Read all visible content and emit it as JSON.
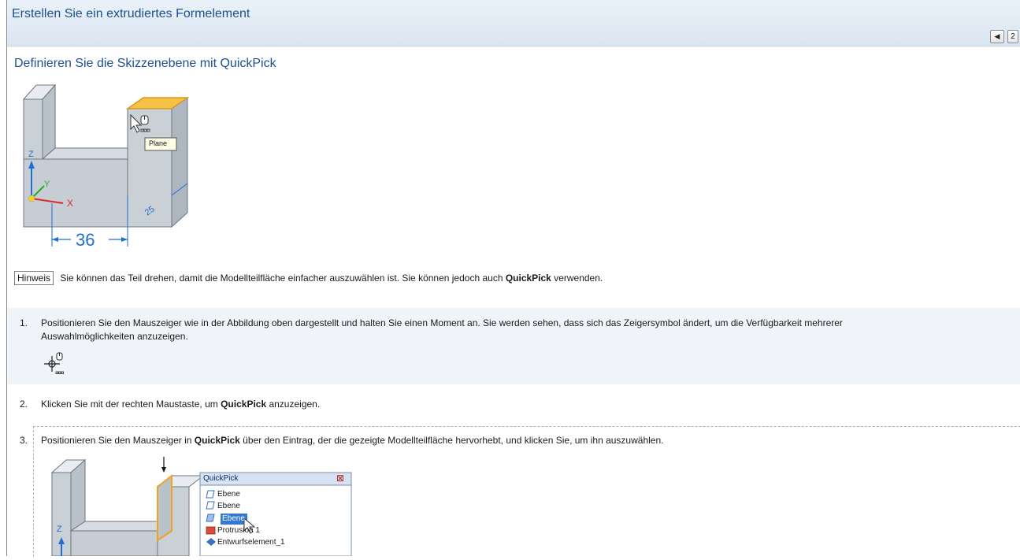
{
  "header": {
    "title": "Erstellen Sie ein extrudiertes Formelement",
    "nav_back_icon": "◀",
    "nav_page": "2"
  },
  "section": {
    "heading": "Definieren Sie die Skizzenebene mit QuickPick"
  },
  "figure1": {
    "tooltip": "Plane",
    "axis_z": "Z",
    "axis_y": "Y",
    "axis_x": "X",
    "dimension": "36",
    "small_dimension": "25",
    "colors": {
      "highlight_face": "#f5c146",
      "axis_blue": "#1f6ed4",
      "axis_red": "#e0262a",
      "axis_green": "#2aa82a"
    }
  },
  "hint": {
    "label": "Hinweis",
    "text_before": " Sie können das Teil drehen, damit die Modellteilfläche einfacher auszuwählen ist. Sie können jedoch auch ",
    "bold": "QuickPick",
    "text_after": " verwenden."
  },
  "steps": [
    {
      "number": "1.",
      "line1": "Positionieren Sie den Mauszeiger wie in der Abbildung oben dargestellt und halten Sie einen Moment an. Sie werden sehen, dass sich das Zeigersymbol ändert, um die Verfügbarkeit mehrerer",
      "line2": "Auswahlmöglichkeiten anzuzeigen.",
      "icon": "quickpick-cursor-icon"
    },
    {
      "number": "2.",
      "text_before": "Klicken Sie mit der rechten Maustaste, um ",
      "bold": "QuickPick",
      "text_after": " anzuzeigen."
    },
    {
      "number": "3.",
      "text_before": "Positionieren Sie den Mauszeiger in ",
      "bold": "QuickPick",
      "text_after": " über den Eintrag, der die gezeigte Modellteilfläche hervorhebt, und klicken Sie, um ihn auszuwählen."
    }
  ],
  "quickpick": {
    "title": "QuickPick",
    "close_icon": "⊠",
    "items": [
      "Ebene",
      "Ebene",
      "Ebene",
      "Protrusion 1",
      "Entwurfselement_1"
    ],
    "selected_index": 2,
    "axis_z": "Z"
  }
}
